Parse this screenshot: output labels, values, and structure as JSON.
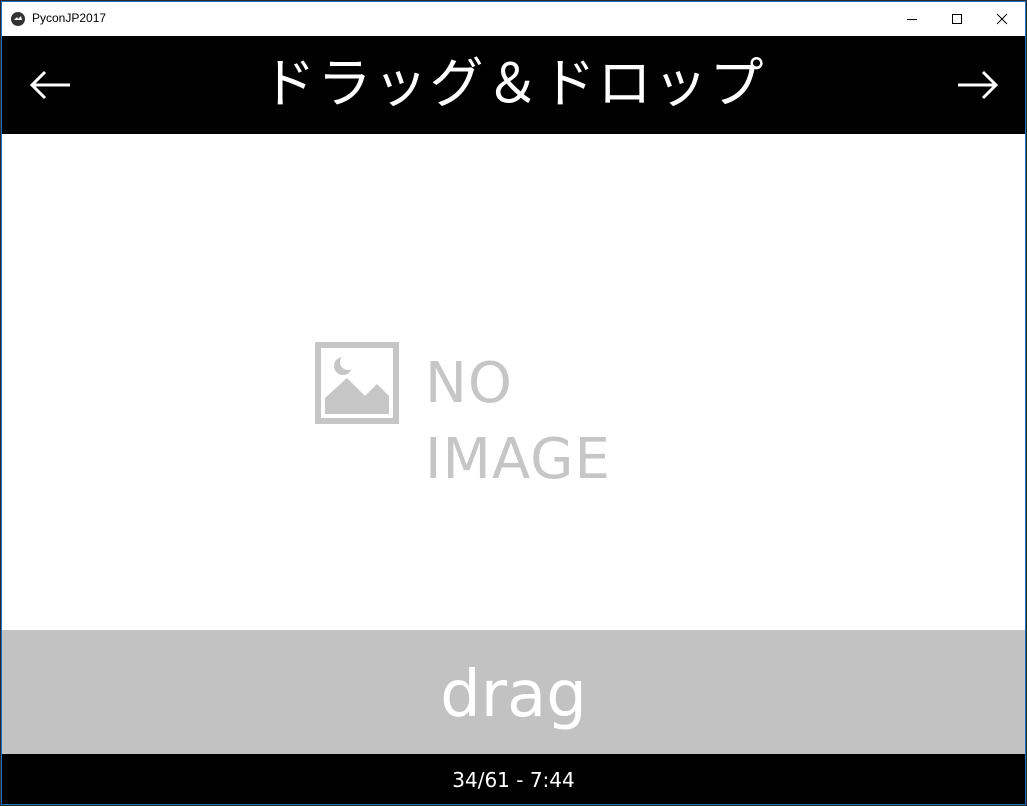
{
  "window": {
    "title": "PyconJP2017",
    "icon": "kivy-app-icon",
    "controls": [
      "minimize-icon",
      "maximize-icon",
      "close-icon"
    ]
  },
  "header": {
    "title": "ドラッグ＆ドロップ",
    "prev_icon": "arrow-left-icon",
    "next_icon": "arrow-right-icon"
  },
  "content": {
    "placeholder_text": "NO IMAGE",
    "placeholder_icon": "image-placeholder-icon"
  },
  "caption": {
    "text": "drag"
  },
  "footer": {
    "status": "34/61 - 7:44"
  },
  "colors": {
    "header_bg": "#000000",
    "caption_bg": "#c2c2c2",
    "placeholder": "#c6c6c6",
    "window_border": "#1f6fbf"
  }
}
